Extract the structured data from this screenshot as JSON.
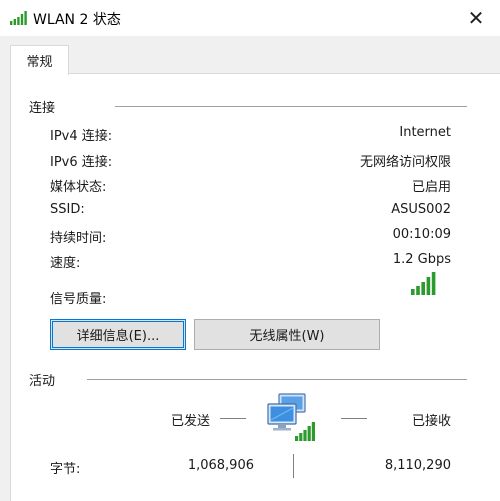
{
  "window": {
    "title": "WLAN 2 状态",
    "close_glyph": "✕",
    "signal_icon": "wifi-signal-icon"
  },
  "tabs": [
    {
      "label": "常规",
      "selected": true
    }
  ],
  "connection": {
    "heading": "连接",
    "rows": [
      {
        "label": "IPv4 连接:",
        "value": "Internet"
      },
      {
        "label": "IPv6 连接:",
        "value": "无网络访问权限"
      },
      {
        "label": "媒体状态:",
        "value": "已启用"
      },
      {
        "label": "SSID:",
        "value": "ASUS002"
      },
      {
        "label": "持续时间:",
        "value": "00:10:09"
      },
      {
        "label": "速度:",
        "value": "1.2 Gbps"
      }
    ],
    "signal_quality_label": "信号质量:",
    "signal_quality_bars": 5,
    "signal_color": "#2d9a2d"
  },
  "buttons": {
    "details": "详细信息(E)...",
    "wireless_properties": "无线属性(W)"
  },
  "activity": {
    "heading": "活动",
    "sent_label": "已发送",
    "received_label": "已接收",
    "bytes_label": "字节:",
    "bytes_sent": "1,068,906",
    "bytes_received": "8,110,290"
  }
}
